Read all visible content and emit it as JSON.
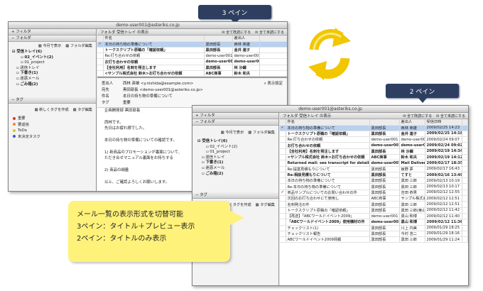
{
  "label_3pane": "3 ペイン",
  "label_2pane": "2 ペイン",
  "callout": {
    "line1": "メール一覧の表示形式を切替可能",
    "line2": "3ペイン：タイトル＋プレビュー表示",
    "line3": "2ペイン：タイトルのみ表示"
  },
  "colors": {
    "tab": "#2d3e60",
    "callout": "#fff27a",
    "arrow": "#f2c600",
    "selected_row": "#b9d0ee"
  },
  "account": "demo-user001@asteriks.co.jp",
  "sidebar": {
    "filter": "フィルタ",
    "folder": "フォルダ",
    "tag": "タグ",
    "folder_actions": {
      "today": "今月で表示",
      "edit": "フォルダ編集"
    },
    "tag_actions": {
      "new": "新しくタグを作成",
      "edit": "タグ編集"
    },
    "tree": [
      "受信トレイ(6)",
      "02_イベント(2)",
      "01_project",
      "送信トレイ",
      "下書き(1)",
      "迷惑メール",
      "ごみ箱(2)"
    ],
    "tags": [
      {
        "name": "重要",
        "color": "#e03030"
      },
      {
        "name": "要返信",
        "color": "#f08a20"
      },
      {
        "name": "ToDo",
        "color": "#e8c020"
      },
      {
        "name": "未決定タスク",
        "color": "#3060c0"
      }
    ]
  },
  "main": {
    "title": "フォルダ 受信トレイ の表示",
    "mark_read": "全て既読にする",
    "mark_unread": "全て未読にする",
    "columns": [
      "件名",
      "差出人",
      "受信日時"
    ],
    "display_settings": "表示設定"
  },
  "mails_3pane": [
    {
      "icon": "✔",
      "subject": "本日の持ち物の準備について",
      "from": "黒田部長",
      "name": "西林 英雄",
      "date": "2009/02/25 14:23",
      "bold": false,
      "sel": true
    },
    {
      "icon": "",
      "subject": "トークスクリプト原稿の「確認依頼」",
      "from": "黒田部長",
      "name": "金井 連子",
      "date": "2009/02/25 14:18",
      "bold": true,
      "sel": false
    },
    {
      "icon": "",
      "subject": "Re:打ち合わせの依頼",
      "from": "demo-user001",
      "name": "demo-user001",
      "date": "2009/02/24 09:07",
      "bold": false,
      "sel": false
    },
    {
      "icon": "",
      "subject": "お打ち合わせの依頼",
      "from": "demo-user001",
      "name": "demo-user001",
      "date": "2009/02/24 09:02",
      "bold": true,
      "sel": false
    },
    {
      "icon": "",
      "subject": "【全社利用】名刺を発注します",
      "from": "黒田部長",
      "name": "林 沙織",
      "date": "2009/02/19 14:34",
      "bold": true,
      "sel": false
    },
    {
      "icon": "",
      "subject": "<サンプル株式会社 鈴木>お打ち合わせの依頼",
      "from": "ABC商事",
      "name": "鈴木 和夫",
      "date": "2009/02/19 14:12",
      "bold": true,
      "sel": false
    }
  ],
  "preview": {
    "from_label": "差出人",
    "from": "西林 英雄 <y.nishida@example.com>",
    "to_label": "宛先",
    "to": "黒田部長 <demo-user001@asteriks.co.jp>",
    "subject_label": "件名",
    "subject": "本日の持ち物の準備について",
    "tag_label": "タグ",
    "tag": "重要",
    "body": [
      "企画開発部 黒田部長",
      "",
      "西林です。",
      "先日はお疲れ様でした。",
      "",
      "本日の持ち物の準備についての確認です。",
      "",
      "1) 新商品のプロモーションが裏面について、",
      "ただき合せマニュアル裏面をお持ちする",
      "",
      "2) 商品の細量",
      "",
      "以上、ご確認よろしくお願いします。"
    ]
  },
  "mails_2pane": [
    {
      "icon": "✔",
      "subject": "本日の持ち物の準備について",
      "from": "黒田部長",
      "name": "西林 英雄",
      "date": "2009/02/25 14:23",
      "bold": false,
      "sel": true
    },
    {
      "icon": "",
      "subject": "トークスクリプト原稿の「確認依頼」",
      "from": "黒田部長",
      "name": "金井 連子",
      "date": "2009/02/25 14:18",
      "bold": true,
      "sel": false
    },
    {
      "icon": "",
      "subject": "Re:打ち合わせの依頼",
      "from": "demo-user001",
      "name": "demo-user001",
      "date": "2009/02/24 09:07",
      "bold": false,
      "sel": false
    },
    {
      "icon": "",
      "subject": "お打ち合わせの依頼",
      "from": "demo-user001",
      "name": "demo-user001",
      "date": "2009/02/24 09:02",
      "bold": true,
      "sel": false
    },
    {
      "icon": "",
      "subject": "【全社利用】名刺を発注します",
      "from": "黒田部長",
      "name": "林 沙織",
      "date": "2009/02/19 14:34",
      "bold": true,
      "sel": false
    },
    {
      "icon": "",
      "subject": "<サンプル株式会社 鈴木>お打ち合わせの依頼",
      "from": "ABC商事",
      "name": "鈴木 和夫",
      "date": "2009/02/19 14:12",
      "bold": true,
      "sel": false
    },
    {
      "icon": "",
      "subject": "Returned mail: see transcript for details",
      "from": "demo-user001",
      "name": "Mail Deliver",
      "date": "2009/02/17 18:35",
      "bold": true,
      "sel": false
    },
    {
      "icon": "",
      "subject": "Re:提案見積もりについて",
      "from": "黒田部長",
      "name": "飯野 夢",
      "date": "2009/02/17 16:43",
      "bold": false,
      "sel": false
    },
    {
      "icon": "",
      "subject": "Re:相談見積もりについて",
      "from": "黒田部長",
      "name": "てすと",
      "date": "2009/02/16 13:49",
      "bold": true,
      "sel": false
    },
    {
      "icon": "",
      "subject": "本日の持ち物の準備について",
      "from": "黒田部長",
      "name": "黒田 三郎",
      "date": "2009/02/13 10:19",
      "bold": false,
      "sel": false
    },
    {
      "icon": "",
      "subject": "Re:本日の持ち物の準備について",
      "from": "黒田部長",
      "name": "黒田 三郎",
      "date": "2009/02/13 10:17",
      "bold": false,
      "sel": false
    },
    {
      "icon": "✔",
      "subject": "商品サンプルについてのお問い合わせの件",
      "from": "黒田部長",
      "name": "吉田 恭男",
      "date": "2009/02/12 12:55",
      "bold": false,
      "sel": false
    },
    {
      "icon": "",
      "subject": "次回のお打ち合わせにて使用し",
      "from": "ABC商事",
      "name": "サンプル株式会社",
      "date": "2009/02/12 12:51",
      "bold": false,
      "sel": false
    },
    {
      "icon": "",
      "subject": "名刺発注の件",
      "from": "黒田部長",
      "name": "黒田 三郎",
      "date": "2009/02/12 12:51",
      "bold": false,
      "sel": false
    },
    {
      "icon": "",
      "subject": "トークスクリプト原稿の「確認依頼」",
      "from": "黒田部長",
      "name": "黒田 三郎(東山)",
      "date": "2009/02/12 11:42",
      "bold": false,
      "sel": false
    },
    {
      "icon": "",
      "subject": "【再送】「ABCワールドイベント2009」",
      "from": "demo-user001",
      "name": "黒山 和博",
      "date": "2009/02/12 11:40",
      "bold": false,
      "sel": false
    },
    {
      "icon": "",
      "subject": "「ABCワールドイベント2009」使用機材の件",
      "from": "demo-user001",
      "name": "黒山 和博",
      "date": "2009/02/12 11:36",
      "bold": true,
      "sel": false
    },
    {
      "icon": "",
      "subject": "チェックリスト(1)",
      "from": "黒田部長",
      "name": "川上 円美",
      "date": "2009/01/29 18:25",
      "bold": false,
      "sel": false
    },
    {
      "icon": "",
      "subject": "チェックリスト報告",
      "from": "黒田部長",
      "name": "今村 浩二",
      "date": "2009/01/29 18:16",
      "bold": false,
      "sel": false
    },
    {
      "icon": "",
      "subject": "ABCワールドイベント2009情報",
      "from": "黒田部長",
      "name": "黒田 三郎",
      "date": "2009/01/29 11:24",
      "bold": false,
      "sel": false
    }
  ]
}
